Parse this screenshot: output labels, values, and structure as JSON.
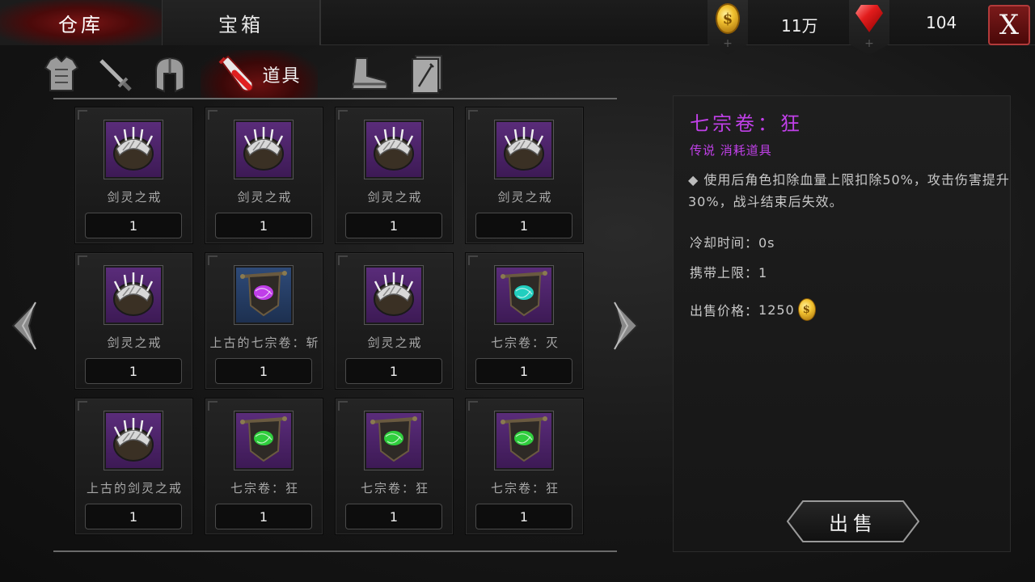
{
  "top_tabs": [
    {
      "label": "仓库",
      "active": true
    },
    {
      "label": "宝箱",
      "active": false
    }
  ],
  "currency": {
    "gold": {
      "icon": "gold-coin-icon",
      "value": "11万"
    },
    "gem": {
      "icon": "ruby-gem-icon",
      "value": "104"
    },
    "plus_symbol": "+"
  },
  "close_label": "X",
  "category_tabs": [
    {
      "icon": "armor-icon"
    },
    {
      "icon": "sword-icon"
    },
    {
      "icon": "helmet-icon"
    },
    {
      "icon": "potion-icon",
      "label": "道具",
      "active": true
    },
    {
      "icon": "boot-icon"
    },
    {
      "icon": "scroll-card-icon"
    }
  ],
  "items": [
    {
      "name": "剑灵之戒",
      "qty": "1",
      "icon": "spiked-ring-icon",
      "bg": "purple"
    },
    {
      "name": "剑灵之戒",
      "qty": "1",
      "icon": "spiked-ring-icon",
      "bg": "purple"
    },
    {
      "name": "剑灵之戒",
      "qty": "1",
      "icon": "spiked-ring-icon",
      "bg": "purple"
    },
    {
      "name": "剑灵之戒",
      "qty": "1",
      "icon": "spiked-ring-icon",
      "bg": "purple"
    },
    {
      "name": "剑灵之戒",
      "qty": "1",
      "icon": "spiked-ring-icon",
      "bg": "purple"
    },
    {
      "name": "上古的七宗卷：斩",
      "qty": "1",
      "icon": "banner-scroll-icon",
      "bg": "blue",
      "glow": "#d040ff"
    },
    {
      "name": "剑灵之戒",
      "qty": "1",
      "icon": "spiked-ring-icon",
      "bg": "purple"
    },
    {
      "name": "七宗卷：灭",
      "qty": "1",
      "icon": "banner-scroll-icon",
      "bg": "purple",
      "glow": "#20e0d0"
    },
    {
      "name": "上古的剑灵之戒",
      "qty": "1",
      "icon": "spiked-ring-icon",
      "bg": "purple"
    },
    {
      "name": "七宗卷：狂",
      "qty": "1",
      "icon": "banner-scroll-icon",
      "bg": "purple",
      "glow": "#30e040"
    },
    {
      "name": "七宗卷：狂",
      "qty": "1",
      "icon": "banner-scroll-icon",
      "bg": "purple",
      "glow": "#30e040"
    },
    {
      "name": "七宗卷：狂",
      "qty": "1",
      "icon": "banner-scroll-icon",
      "bg": "purple",
      "glow": "#30e040"
    }
  ],
  "detail": {
    "title": "七宗卷：狂",
    "subtitle": "传说 消耗道具",
    "bullet": "◆",
    "description": "使用后角色扣除血量上限扣除50%，攻击伤害提升30%，战斗结束后失效。",
    "cooldown": "冷却时间：0s",
    "carry_limit": "携带上限：1",
    "sell_price_label": "出售价格：",
    "sell_price": "1250",
    "sell_button": "出售"
  },
  "colors": {
    "legend_purple": "#c040e8",
    "active_red": "#7a1414"
  }
}
